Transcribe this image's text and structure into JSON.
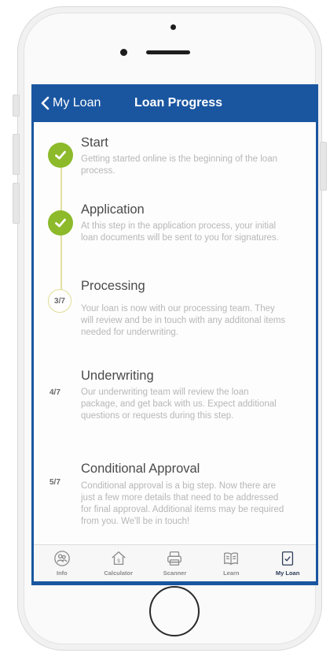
{
  "nav": {
    "back_label": "My Loan",
    "title": "Loan Progress"
  },
  "steps": [
    {
      "title": "Start",
      "description": "Getting started online is the beginning of the loan process.",
      "status": "complete",
      "badge": ""
    },
    {
      "title": "Application",
      "description": "At this step in the application process, your initial loan documents will be sent to you for signatures.",
      "status": "complete",
      "badge": ""
    },
    {
      "title": "Processing",
      "description": "Your loan is now with our processing team. They will review and be in touch with any additonal items needed for underwriting.",
      "status": "current",
      "badge": "3/7"
    },
    {
      "title": "Underwriting",
      "description": "Our underwriting team will review the loan package, and get back with us. Expect additional questions or requests during this step.",
      "status": "pending",
      "badge": "4/7"
    },
    {
      "title": "Conditional Approval",
      "description": "Conditional approval is a big step. Now there are just a few more details that need to be addressed for final approval.  Additional items may be required from you.  We'll be in touch!",
      "status": "pending",
      "badge": "5/7"
    }
  ],
  "tabs": [
    {
      "label": "Info",
      "icon": "info-people-icon",
      "active": false
    },
    {
      "label": "Calculator",
      "icon": "calculator-house-icon",
      "active": false
    },
    {
      "label": "Scanner",
      "icon": "scanner-icon",
      "active": false
    },
    {
      "label": "Learn",
      "icon": "book-icon",
      "active": false
    },
    {
      "label": "My Loan",
      "icon": "loan-document-icon",
      "active": true
    }
  ],
  "colors": {
    "nav_blue": "#1a56a0",
    "check_green": "#8cba2a",
    "timeline_line": "#e3dfa2",
    "active_tab": "#2c3b57"
  }
}
